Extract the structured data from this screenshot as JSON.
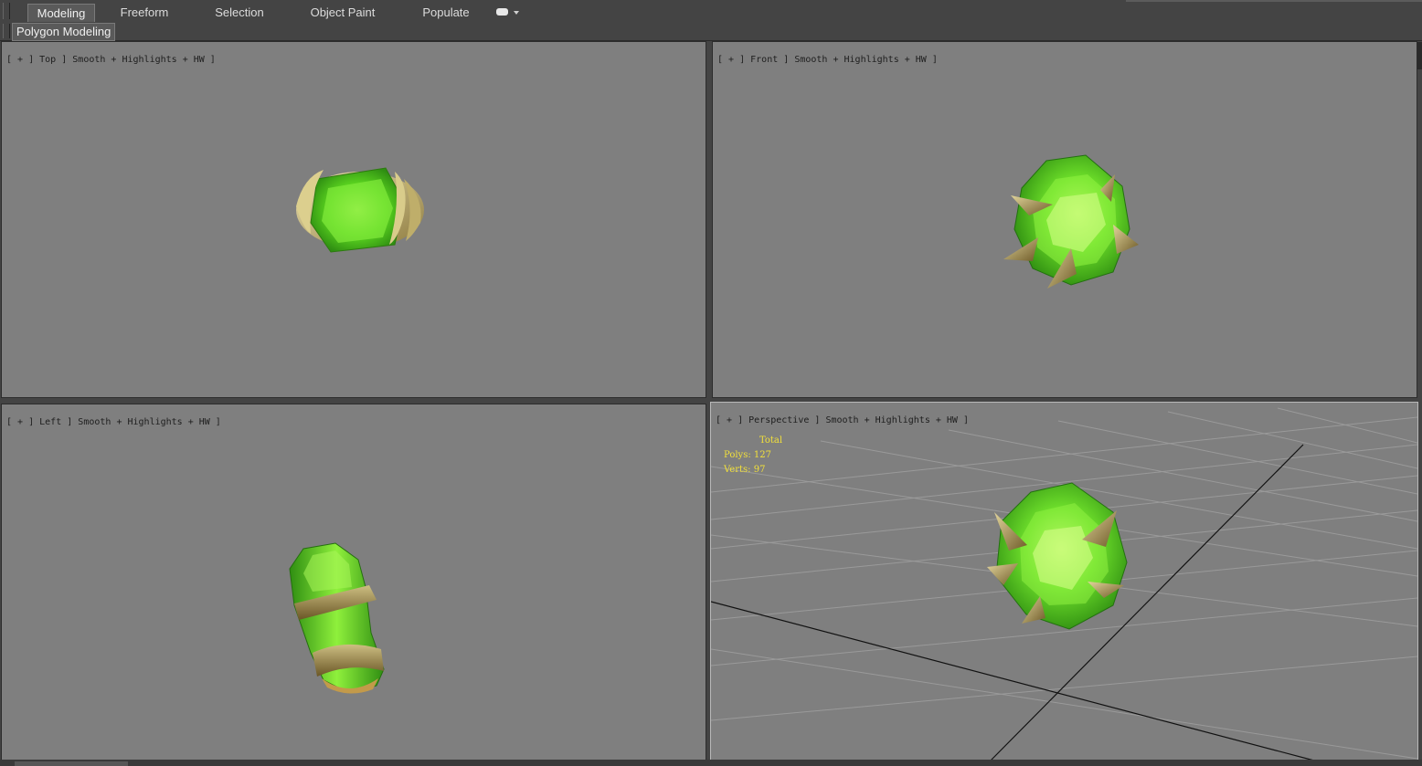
{
  "ribbon": {
    "tabs": [
      {
        "label": "Modeling",
        "active": true
      },
      {
        "label": "Freeform",
        "active": false
      },
      {
        "label": "Selection",
        "active": false
      },
      {
        "label": "Object Paint",
        "active": false
      },
      {
        "label": "Populate",
        "active": false
      }
    ],
    "panel_label": "Polygon Modeling"
  },
  "viewports": {
    "top": {
      "plus": "[ + ]",
      "view": "Top ]",
      "shading": "Smooth + Highlights + HW ]"
    },
    "front": {
      "plus": "[ + ]",
      "view": "Front ]",
      "shading": "Smooth + Highlights + HW ]"
    },
    "left": {
      "plus": "[ + ]",
      "view": "Left ]",
      "shading": "Smooth + Highlights + HW ]"
    },
    "persp": {
      "plus": "[ + ]",
      "view": "Perspective ]",
      "shading": "Smooth + Highlights + HW ]"
    }
  },
  "stats": {
    "header": "Total",
    "polys": "Polys: 127",
    "verts": "Verts: 97"
  },
  "colors": {
    "viewport_bg": "#7f7f7f",
    "ui_bg": "#444444",
    "gem_green": "#5cd620",
    "stats_text": "#f2e03a"
  }
}
